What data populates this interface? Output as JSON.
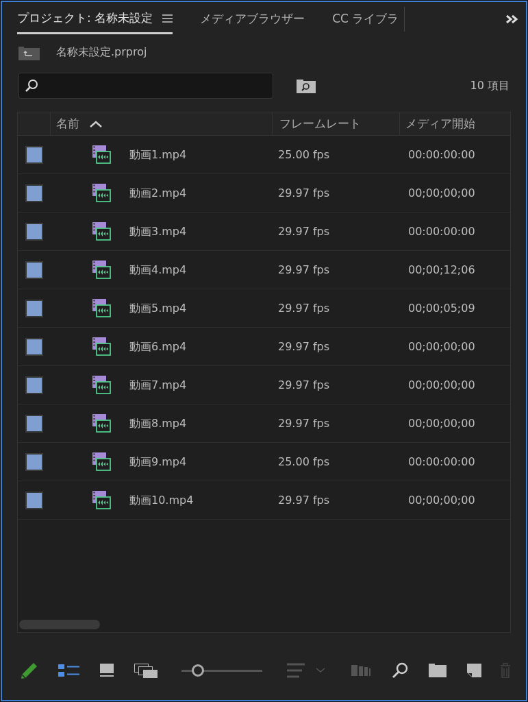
{
  "tabs": [
    {
      "label": "プロジェクト: 名称未設定",
      "selected": true
    },
    {
      "label": "メディアブラウザー",
      "selected": false
    },
    {
      "label": "CC ライブラ",
      "selected": false
    }
  ],
  "project": {
    "file": "名称未設定.prproj"
  },
  "search": {
    "count": "10 項目"
  },
  "table": {
    "columns": [
      "名前",
      "フレームレート",
      "メディア開始"
    ],
    "rows": [
      {
        "color": "#7f9fd0",
        "name": "動画1.mp4",
        "frame_rate": "25.00 fps",
        "media_start": "00:00:00:00"
      },
      {
        "color": "#7f9fd0",
        "name": "動画2.mp4",
        "frame_rate": "29.97 fps",
        "media_start": "00;00;00;00"
      },
      {
        "color": "#7f9fd0",
        "name": "動画3.mp4",
        "frame_rate": "29.97 fps",
        "media_start": "00:00:00:00"
      },
      {
        "color": "#7f9fd0",
        "name": "動画4.mp4",
        "frame_rate": "29.97 fps",
        "media_start": "00;00;12;06"
      },
      {
        "color": "#7f9fd0",
        "name": "動画5.mp4",
        "frame_rate": "29.97 fps",
        "media_start": "00;00;05;09"
      },
      {
        "color": "#7f9fd0",
        "name": "動画6.mp4",
        "frame_rate": "29.97 fps",
        "media_start": "00;00;00;00"
      },
      {
        "color": "#7f9fd0",
        "name": "動画7.mp4",
        "frame_rate": "29.97 fps",
        "media_start": "00;00;00;00"
      },
      {
        "color": "#7f9fd0",
        "name": "動画8.mp4",
        "frame_rate": "29.97 fps",
        "media_start": "00;00;00;00"
      },
      {
        "color": "#7f9fd0",
        "name": "動画9.mp4",
        "frame_rate": "25.00 fps",
        "media_start": "00:00:00:00"
      },
      {
        "color": "#7f9fd0",
        "name": "動画10.mp4",
        "frame_rate": "29.97 fps",
        "media_start": "00;00;00;00"
      }
    ]
  },
  "toolbar": {
    "zoom": {
      "level": 0.2
    }
  }
}
